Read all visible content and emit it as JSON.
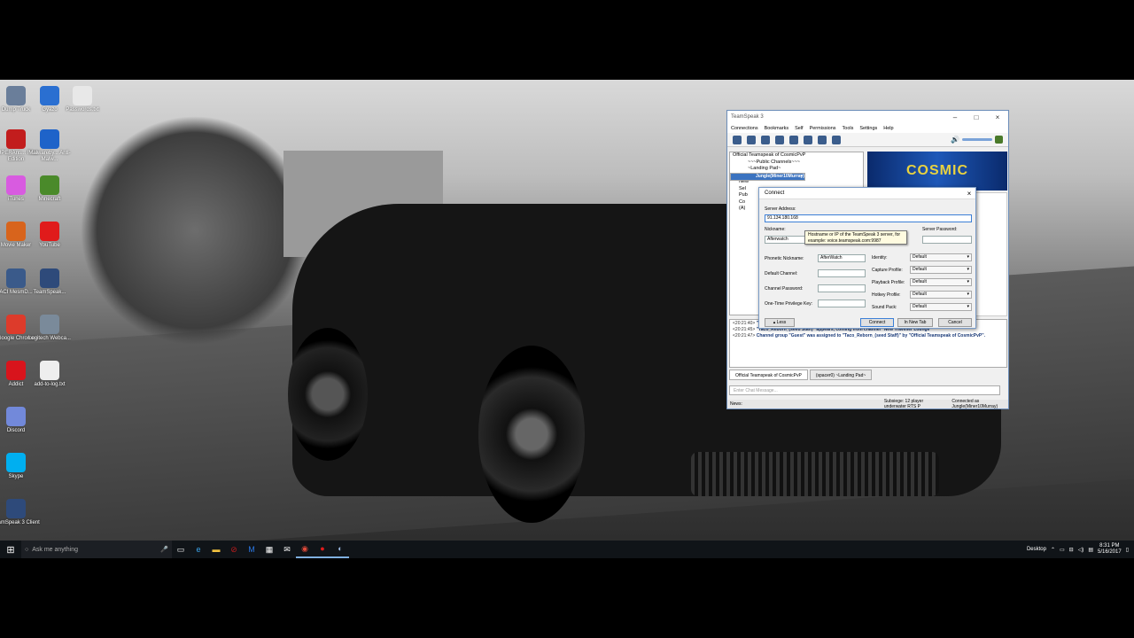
{
  "desktop": {
    "icons": [
      {
        "label": "Dump Truck",
        "color": "#6a7e9a"
      },
      {
        "label": "Gyazo",
        "color": "#2a6fd1"
      },
      {
        "label": "Passwords.txt",
        "color": "#e8e8e8"
      },
      {
        "label": "SUPERAnti... Free Edition",
        "color": "#c21d1d"
      },
      {
        "label": "Malwareby... Anti-Malw...",
        "color": "#1e63c9"
      },
      {
        "label": "iTunes",
        "color": "#d85be0"
      },
      {
        "label": "Minecraft",
        "color": "#4a8a2a"
      },
      {
        "label": "Movie Maker",
        "color": "#d8641c"
      },
      {
        "label": "YouTube",
        "color": "#e01b1b"
      },
      {
        "label": "ACI MesmD...",
        "color": "#3a5a8a"
      },
      {
        "label": "TeamSpeak...",
        "color": "#2e4a7a"
      },
      {
        "label": "Google Chrome",
        "color": "#dd3b2b"
      },
      {
        "label": "Logitech Webca...",
        "color": "#7a8a9a"
      },
      {
        "label": "Addict",
        "color": "#d8141c"
      },
      {
        "label": "add-to-log.txt",
        "color": "#eeeeee"
      },
      {
        "label": "Discord",
        "color": "#7289da"
      },
      {
        "label": "Skype",
        "color": "#00aff0"
      },
      {
        "label": "TeamSpeak 3 Client",
        "color": "#2e4a7a"
      }
    ]
  },
  "taskbar": {
    "search_placeholder": "Ask me anything",
    "tray_label": "Desktop",
    "time": "8:31 PM",
    "date": "5/16/2017"
  },
  "ts": {
    "title": "TeamSpeak 3",
    "menu": [
      "Connections",
      "Bookmarks",
      "Self",
      "Permissions",
      "Tools",
      "Settings",
      "Help"
    ],
    "tree": [
      {
        "text": "Official Teamspeak of CosmicPvP",
        "sel": false
      },
      {
        "text": "~~~Public Channels~~~",
        "sel": false
      },
      {
        "text": "~Landing Pad~",
        "sel": false
      },
      {
        "text": "Jungle(Miner10Murray)",
        "sel": true
      },
      {
        "text": "Shinee",
        "sel": false
      },
      {
        "text": "New",
        "sel": false
      },
      {
        "text": "Sel",
        "sel": false
      },
      {
        "text": "Pub",
        "sel": false
      },
      {
        "text": "Co",
        "sel": false
      },
      {
        "text": "(A)",
        "sel": false
      }
    ],
    "banner": "COSMIC",
    "log": [
      {
        "time": "<20:21:40>",
        "text": "\"Taco_Reborn_(seed Staff)\" left heading to channel \"New Traveller Lounge\""
      },
      {
        "time": "<20:21:45>",
        "text": "\"Taco_Reborn_(seed Staff)\" appears, coming from channel \"New Traveller Lounge\""
      },
      {
        "time": "<20:21:47>",
        "text": "Channel group \"Guest\" was assigned to \"Taco_Reborn_(seed Staff)\" by \"Official Teamspeak of CosmicPvP\"."
      }
    ],
    "tabs": [
      "Official Teamspeak of CosmicPvP",
      "(spacer0) ~Landing Pad~"
    ],
    "chat_placeholder": "Enter Chat Message...",
    "status_left": "News:",
    "status_mid": "Subsiege: 12 player underwater RTS P",
    "status_right": "Connected as Jungle(Miner10Murray)"
  },
  "dialog": {
    "title": "Connect",
    "server_address_label": "Server Address:",
    "server_address_value": "91.134.180.168",
    "nickname_label": "Nickname:",
    "nickname_value": "Afterwatch",
    "server_password_label": "Server Password:",
    "tooltip": "Hostname or IP of the TeamSpeak 3 server, for example: voice.teamspeak.com:9987",
    "phonetic_label": "Phonetic Nickname:",
    "phonetic_value": "AfterWatch",
    "default_channel_label": "Default Channel:",
    "channel_password_label": "Channel Password:",
    "otp_label": "One-Time Privilege Key:",
    "identity_label": "Identity:",
    "capture_label": "Capture Profile:",
    "playback_label": "Playback Profile:",
    "hotkey_label": "Hotkey Profile:",
    "sound_label": "Sound Pack:",
    "default_value": "Default",
    "less_button": "Less",
    "connect_button": "Connect",
    "newtab_button": "In New Tab",
    "cancel_button": "Cancel"
  }
}
